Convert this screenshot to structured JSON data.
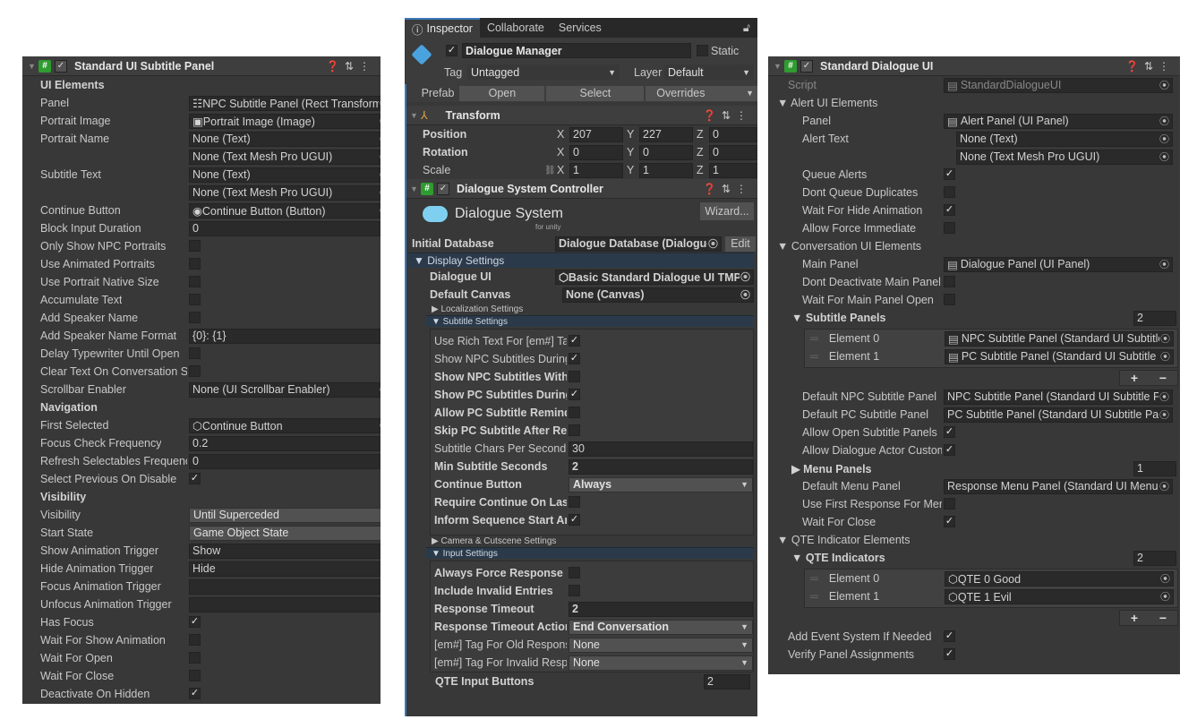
{
  "left": {
    "title": "Standard UI Subtitle Panel",
    "rows": [
      {
        "label": "UI Elements",
        "bold": true
      },
      {
        "label": "Panel",
        "type": "obj",
        "value": "☷NPC Subtitle Panel (Rect Transform)"
      },
      {
        "label": "Portrait Image",
        "type": "obj",
        "value": "▣Portrait Image (Image)"
      },
      {
        "label": "Portrait Name",
        "type": "obj",
        "value": "None (Text)"
      },
      {
        "label": "",
        "type": "obj",
        "value": "None (Text Mesh Pro UGUI)"
      },
      {
        "label": "Subtitle Text",
        "type": "obj",
        "value": "None (Text)"
      },
      {
        "label": "",
        "type": "obj",
        "value": "None (Text Mesh Pro UGUI)"
      },
      {
        "label": "Continue Button",
        "type": "obj",
        "value": "◉Continue Button (Button)"
      },
      {
        "label": "Block Input Duration",
        "type": "text",
        "value": "0"
      },
      {
        "label": "Only Show NPC Portraits",
        "type": "check",
        "checked": false
      },
      {
        "label": "Use Animated Portraits",
        "type": "check",
        "checked": false
      },
      {
        "label": "Use Portrait Native Size",
        "type": "check",
        "checked": false
      },
      {
        "label": "Accumulate Text",
        "type": "check",
        "checked": false
      },
      {
        "label": "Add Speaker Name",
        "type": "check",
        "checked": false
      },
      {
        "label": "Add Speaker Name Format",
        "type": "text",
        "value": "{0}: {1}"
      },
      {
        "label": "Delay Typewriter Until Open",
        "type": "check",
        "checked": false
      },
      {
        "label": "Clear Text On Conversation Start",
        "type": "check",
        "checked": false
      },
      {
        "label": "Scrollbar Enabler",
        "type": "obj",
        "value": "None (UI Scrollbar Enabler)"
      },
      {
        "label": "Navigation",
        "bold": true
      },
      {
        "label": "First Selected",
        "type": "obj",
        "value": "⬡Continue Button"
      },
      {
        "label": "Focus Check Frequency",
        "type": "text",
        "value": "0.2"
      },
      {
        "label": "Refresh Selectables Frequency",
        "type": "text",
        "value": "0"
      },
      {
        "label": "Select Previous On Disable",
        "type": "check",
        "checked": true
      },
      {
        "label": "Visibility",
        "bold": true
      },
      {
        "label": "Visibility",
        "type": "drop",
        "value": "Until Superceded"
      },
      {
        "label": "Start State",
        "type": "drop",
        "value": "Game Object State"
      },
      {
        "label": "Show Animation Trigger",
        "type": "text",
        "value": "Show"
      },
      {
        "label": "Hide Animation Trigger",
        "type": "text",
        "value": "Hide"
      },
      {
        "label": "Focus Animation Trigger",
        "type": "text",
        "value": ""
      },
      {
        "label": "Unfocus Animation Trigger",
        "type": "text",
        "value": ""
      },
      {
        "label": "Has Focus",
        "type": "check",
        "checked": true
      },
      {
        "label": "Wait For Show Animation",
        "type": "check",
        "checked": false
      },
      {
        "label": "Wait For Open",
        "type": "check",
        "checked": false
      },
      {
        "label": "Wait For Close",
        "type": "check",
        "checked": false
      },
      {
        "label": "Deactivate On Hidden",
        "type": "check",
        "checked": true
      }
    ]
  },
  "middle": {
    "tabs": [
      "Inspector",
      "Collaborate",
      "Services"
    ],
    "object_name": "Dialogue Manager",
    "static_label": "Static",
    "tag_label": "Tag",
    "tag_value": "Untagged",
    "layer_label": "Layer",
    "layer_value": "Default",
    "prefab_label": "Prefab",
    "prefab_buttons": [
      "Open",
      "Select",
      "Overrides"
    ],
    "transform_title": "Transform",
    "transform": [
      {
        "label": "Position",
        "x": "207",
        "y": "227",
        "z": "0"
      },
      {
        "label": "Rotation",
        "x": "0",
        "y": "0",
        "z": "0"
      },
      {
        "label": "Scale",
        "x": "1",
        "y": "1",
        "z": "1"
      }
    ],
    "controller_title": "Dialogue System Controller",
    "logo_text": "Dialogue System",
    "logo_sub": "for unity",
    "wizard_label": "Wizard...",
    "initial_db_label": "Initial Database",
    "initial_db_value": "Dialogue Database (Dialogue Database)",
    "edit_label": "Edit",
    "display_settings": "▼ Display Settings",
    "dialogue_ui_label": "Dialogue UI",
    "dialogue_ui_value": "⬡Basic Standard Dialogue UI TMP",
    "default_canvas_label": "Default Canvas",
    "default_canvas_value": "None (Canvas)",
    "localization": "▶ Localization Settings",
    "subtitle_settings": "▼ Subtitle Settings",
    "subtitle_rows": [
      {
        "label": "Use Rich Text For [em#] Tags",
        "type": "check",
        "checked": true,
        "bold": false
      },
      {
        "label": "Show NPC Subtitles During Line",
        "type": "check",
        "checked": true,
        "bold": false
      },
      {
        "label": "Show NPC Subtitles With Responses",
        "type": "check",
        "checked": false,
        "bold": true
      },
      {
        "label": "Show PC Subtitles During Line",
        "type": "check",
        "checked": true,
        "bold": true
      },
      {
        "label": "Allow PC Subtitle Reminders",
        "type": "check",
        "checked": false,
        "bold": true
      },
      {
        "label": "Skip PC Subtitle After Response Menu",
        "type": "check",
        "checked": false,
        "bold": true
      },
      {
        "label": "Subtitle Chars Per Second",
        "type": "text",
        "value": "30",
        "bold": false
      },
      {
        "label": "Min Subtitle Seconds",
        "type": "text",
        "value": "2",
        "bold": true
      },
      {
        "label": "Continue Button",
        "type": "drop",
        "value": "Always",
        "bold": true
      },
      {
        "label": "Require Continue On Last Line",
        "type": "check",
        "checked": false,
        "bold": true
      },
      {
        "label": "Inform Sequence Start And End",
        "type": "check",
        "checked": true,
        "bold": true
      }
    ],
    "camera": "▶ Camera & Cutscene Settings",
    "input_settings": "▼ Input Settings",
    "input_rows": [
      {
        "label": "Always Force Response Menu",
        "type": "check",
        "checked": false,
        "bold": true
      },
      {
        "label": "Include Invalid Entries",
        "type": "check",
        "checked": false,
        "bold": true
      },
      {
        "label": "Response Timeout",
        "type": "text",
        "value": "2",
        "bold": true
      },
      {
        "label": "Response Timeout Action",
        "type": "drop",
        "value": "End Conversation",
        "bold": true
      },
      {
        "label": "[em#] Tag For Old Responses",
        "type": "drop",
        "value": "None",
        "bold": false
      },
      {
        "label": "[em#] Tag For Invalid Responses",
        "type": "drop",
        "value": "None",
        "bold": false
      }
    ],
    "qte_buttons_label": "QTE Input Buttons",
    "qte_buttons_count": "2"
  },
  "right": {
    "title": "Standard Dialogue UI",
    "script_label": "Script",
    "script_value": "StandardDialogueUI",
    "rows": [
      {
        "label": "▼ Alert UI Elements",
        "indent": 0,
        "type": "fold"
      },
      {
        "label": "Panel",
        "indent": 1,
        "type": "obj",
        "value": "Alert Panel (UI Panel)",
        "icon": true
      },
      {
        "label": "Alert Text",
        "indent": 1,
        "type": "obj",
        "value": "None (Text)",
        "icon": false,
        "offset": true
      },
      {
        "label": "",
        "indent": 1,
        "type": "obj",
        "value": "None (Text Mesh Pro UGUI)",
        "icon": false,
        "offset": true
      },
      {
        "label": "Queue Alerts",
        "indent": 1,
        "type": "check",
        "checked": true
      },
      {
        "label": "Dont Queue Duplicates",
        "indent": 1,
        "type": "check",
        "checked": false
      },
      {
        "label": "Wait For Hide Animation",
        "indent": 1,
        "type": "check",
        "checked": true
      },
      {
        "label": "Allow Force Immediate",
        "indent": 1,
        "type": "check",
        "checked": false
      },
      {
        "label": "▼ Conversation UI Elements",
        "indent": 0,
        "type": "fold"
      },
      {
        "label": "Main Panel",
        "indent": 1,
        "type": "obj",
        "value": "Dialogue Panel (UI Panel)",
        "icon": true
      },
      {
        "label": "Dont Deactivate Main Panel",
        "indent": 1,
        "type": "check",
        "checked": false
      },
      {
        "label": "Wait For Main Panel Open",
        "indent": 1,
        "type": "check",
        "checked": false
      }
    ],
    "subtitle_panels_label": "▼ Subtitle Panels",
    "subtitle_panels_count": "2",
    "subtitle_elements": [
      {
        "label": "Element 0",
        "value": "NPC Subtitle Panel (Standard UI Subtitle Panel)"
      },
      {
        "label": "Element 1",
        "value": "PC Subtitle Panel (Standard UI Subtitle Panel)"
      }
    ],
    "rows2": [
      {
        "label": "Default NPC Subtitle Panel",
        "type": "obj",
        "value": "NPC Subtitle Panel (Standard UI Subtitle Panel)"
      },
      {
        "label": "Default PC Subtitle Panel",
        "type": "obj",
        "value": "PC Subtitle Panel (Standard UI Subtitle Panel)"
      },
      {
        "label": "Allow Open Subtitle Panels",
        "type": "check",
        "checked": true
      },
      {
        "label": "Allow Dialogue Actor Custom Panels",
        "type": "check",
        "checked": true
      }
    ],
    "menu_panels_label": "▶ Menu Panels",
    "menu_panels_count": "1",
    "rows3": [
      {
        "label": "Default Menu Panel",
        "type": "obj",
        "value": "Response Menu Panel (Standard UI Menu Panel)"
      },
      {
        "label": "Use First Response For Menu Panel",
        "type": "check",
        "checked": false
      },
      {
        "label": "Wait For Close",
        "type": "check",
        "checked": true
      }
    ],
    "qte_elements_label": "▼ QTE Indicator Elements",
    "qte_indicators_label": "▼ QTE Indicators",
    "qte_indicators_count": "2",
    "qte_elements": [
      {
        "label": "Element 0",
        "value": "⬡QTE 0 Good"
      },
      {
        "label": "Element 1",
        "value": "⬡QTE 1 Evil"
      }
    ],
    "rows4": [
      {
        "label": "Add Event System If Needed",
        "type": "check",
        "checked": true
      },
      {
        "label": "Verify Panel Assignments",
        "type": "check",
        "checked": true
      }
    ]
  }
}
